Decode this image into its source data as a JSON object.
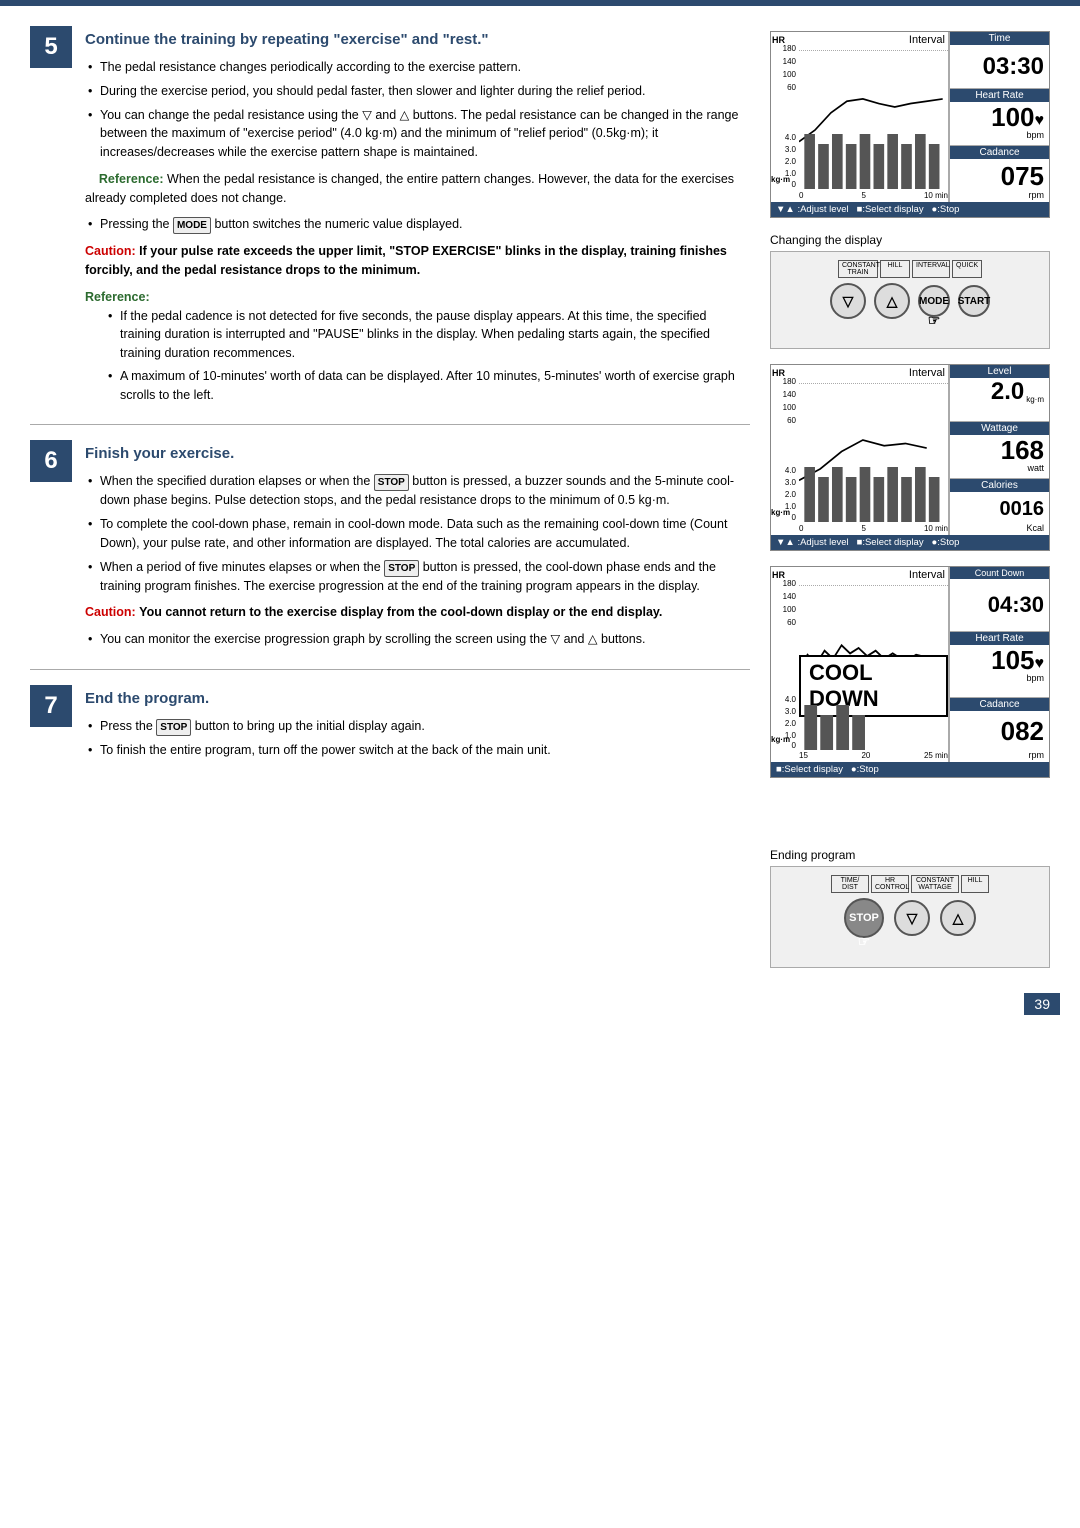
{
  "top_bar": {
    "color": "#2c4a6e"
  },
  "sections": [
    {
      "number": "5",
      "title": "Continue the training by repeating \"exercise\" and \"rest.\"",
      "bullets": [
        "The pedal resistance changes periodically according to the exercise pattern.",
        "During the exercise period, you should pedal faster, then slower and lighter during the relief period.",
        "You can change the pedal resistance using the ▽ and △ buttons. The pedal resistance can be changed in the range between the maximum of \"exercise period\" (4.0 kg·m) and the minimum of \"relief period\" (0.5kg·m); it increases/decreases while the exercise pattern shape is maintained."
      ],
      "reference1": {
        "label": "Reference:",
        "text": "When the pedal resistance is changed, the entire pattern changes. However, the data for the exercises already completed does not change."
      },
      "bullet_mode": "Pressing the MODE button switches the numeric value displayed.",
      "caution": {
        "label": "Caution:",
        "text": "If your pulse rate exceeds the upper limit, \"STOP EXERCISE\" blinks in the display, training finishes forcibly, and the pedal resistance drops to the minimum."
      },
      "reference2": {
        "label": "Reference:",
        "sub_bullets": [
          "If the pedal cadence is not detected for five seconds, the pause display appears. At this time, the specified training duration is interrupted and \"PAUSE\" blinks in the display. When pedaling starts again, the specified training duration recommences.",
          "A maximum of 10-minutes' worth of data can be displayed. After 10 minutes, 5-minutes' worth of exercise graph scrolls to the left."
        ]
      }
    },
    {
      "number": "6",
      "title": "Finish your exercise.",
      "bullets": [
        "When the specified duration elapses or when the STOP button is pressed, a buzzer sounds and the 5-minute cool-down phase begins. Pulse detection stops, and the pedal resistance drops to the minimum of 0.5 kg·m.",
        "To complete the cool-down phase, remain in cool-down mode. Data such as the remaining cool-down time (Count Down), your pulse rate, and other information are displayed. The total calories are accumulated.",
        "When a period of five minutes elapses or when the STOP button is pressed, the cool-down phase ends and the training program finishes. The exercise progression at the end of the training program appears in the display."
      ],
      "caution": {
        "label": "Caution:",
        "text": "You cannot return to the exercise display from the cool-down display or the end display."
      },
      "bullet_extra": "You can monitor the exercise progression graph by scrolling the screen using the ▽ and △ buttons."
    },
    {
      "number": "7",
      "title": "End the program.",
      "bullets": [
        "Press the STOP button to bring up the initial display again.",
        "To finish the entire program, turn off the power switch at the back of the main unit."
      ]
    }
  ],
  "panels": {
    "panel1": {
      "caption": "",
      "label": "Interval",
      "graph_title": "Interval",
      "hr_label": "HR",
      "y_hr": [
        "180",
        "140",
        "100",
        "60",
        "0"
      ],
      "y_kgm": [
        "4.0",
        "3.0",
        "2.0",
        "1.0",
        "0"
      ],
      "x_axis": [
        "0",
        "5",
        "10 min"
      ],
      "info": [
        {
          "label": "Time",
          "value": "03:30",
          "unit": ""
        },
        {
          "label": "Heart Rate",
          "value": "100",
          "unit": "bpm",
          "heart": true
        },
        {
          "label": "Cadance",
          "value": "075",
          "unit": "rpm"
        }
      ],
      "bottom_bar": "▼▲ :Adjust level   ■:Select display   ●:Stop"
    },
    "panel2": {
      "caption": "Changing the display",
      "buttons": [
        "▽",
        "△",
        "MODE",
        "START"
      ],
      "mode_labels": [
        "CONSTANT\nTRAIN",
        "HILL",
        "INTERVAL",
        "QUICK"
      ]
    },
    "panel3": {
      "label": "Interval",
      "info": [
        {
          "label": "Level",
          "value": "2.0",
          "unit": "kg·m"
        },
        {
          "label": "Wattage",
          "value": "168",
          "unit": "watt"
        },
        {
          "label": "Calories",
          "value": "0016",
          "unit": "Kcal"
        }
      ],
      "bottom_bar": "▼▲ :Adjust level   ■:Select display   ●:Stop"
    },
    "panel4": {
      "caption": "",
      "label": "Interval",
      "cool_down_text": "COOL DOWN",
      "info": [
        {
          "label": "Count Down",
          "value": "04:30",
          "unit": ""
        },
        {
          "label": "Heart Rate",
          "value": "105",
          "unit": "bpm",
          "heart": true
        },
        {
          "label": "Cadance",
          "value": "082",
          "unit": "rpm"
        }
      ],
      "x_axis": [
        "15",
        "20",
        "25 min"
      ],
      "bottom_bar": "■:Select display   ●:Stop"
    },
    "panel5": {
      "caption": "Ending program",
      "mode_labels": [
        "TIME/DIST",
        "HR CONTROL",
        "CONSTANT WATTAGE",
        "HILL"
      ],
      "buttons": [
        "STOP",
        "▽",
        "△"
      ]
    }
  },
  "page_number": "39"
}
